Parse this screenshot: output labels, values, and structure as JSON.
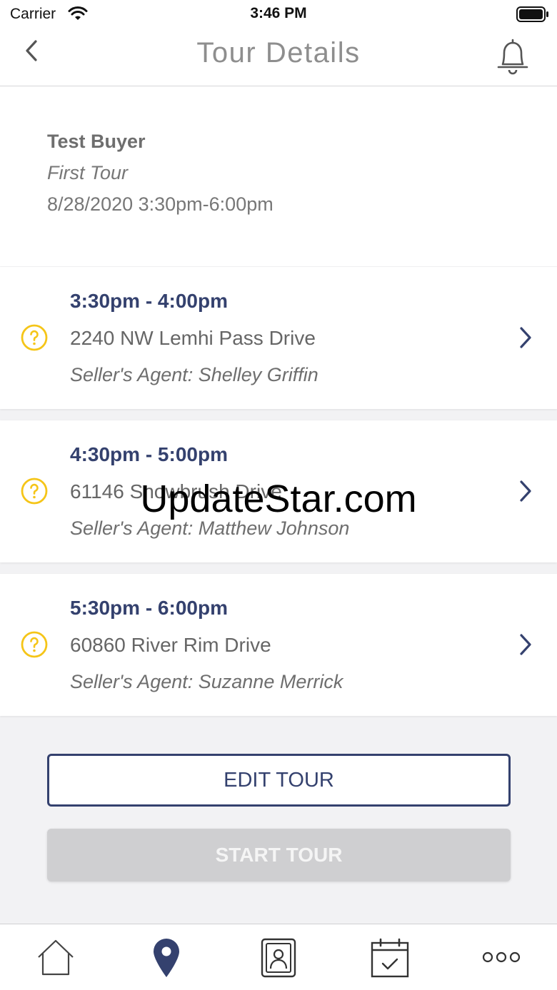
{
  "status_bar": {
    "carrier": "Carrier",
    "time": "3:46 PM"
  },
  "nav": {
    "title": "Tour Details"
  },
  "summary": {
    "buyer_name": "Test Buyer",
    "tour_name": "First Tour",
    "datetime": "8/28/2020 3:30pm-6:00pm"
  },
  "stops": [
    {
      "time": "3:30pm - 4:00pm",
      "address": "2240 NW Lemhi Pass Drive",
      "agent": "Seller's Agent: Shelley Griffin",
      "status_icon": "question-circle-icon"
    },
    {
      "time": "4:30pm - 5:00pm",
      "address": "61146 Snowbrush Drive",
      "agent": "Seller's Agent: Matthew Johnson",
      "status_icon": "question-circle-icon"
    },
    {
      "time": "5:30pm - 6:00pm",
      "address": "60860 River Rim Drive",
      "agent": "Seller's Agent: Suzanne Merrick",
      "status_icon": "question-circle-icon"
    }
  ],
  "actions": {
    "edit_label": "EDIT TOUR",
    "start_label": "START TOUR"
  },
  "tabs": [
    "home-icon",
    "map-pin-icon",
    "contacts-icon",
    "calendar-check-icon",
    "more-icon"
  ],
  "watermark": "UpdateStar.com",
  "colors": {
    "accent": "#34416e",
    "pending": "#f5c518",
    "disabled": "#cfcfd1"
  }
}
